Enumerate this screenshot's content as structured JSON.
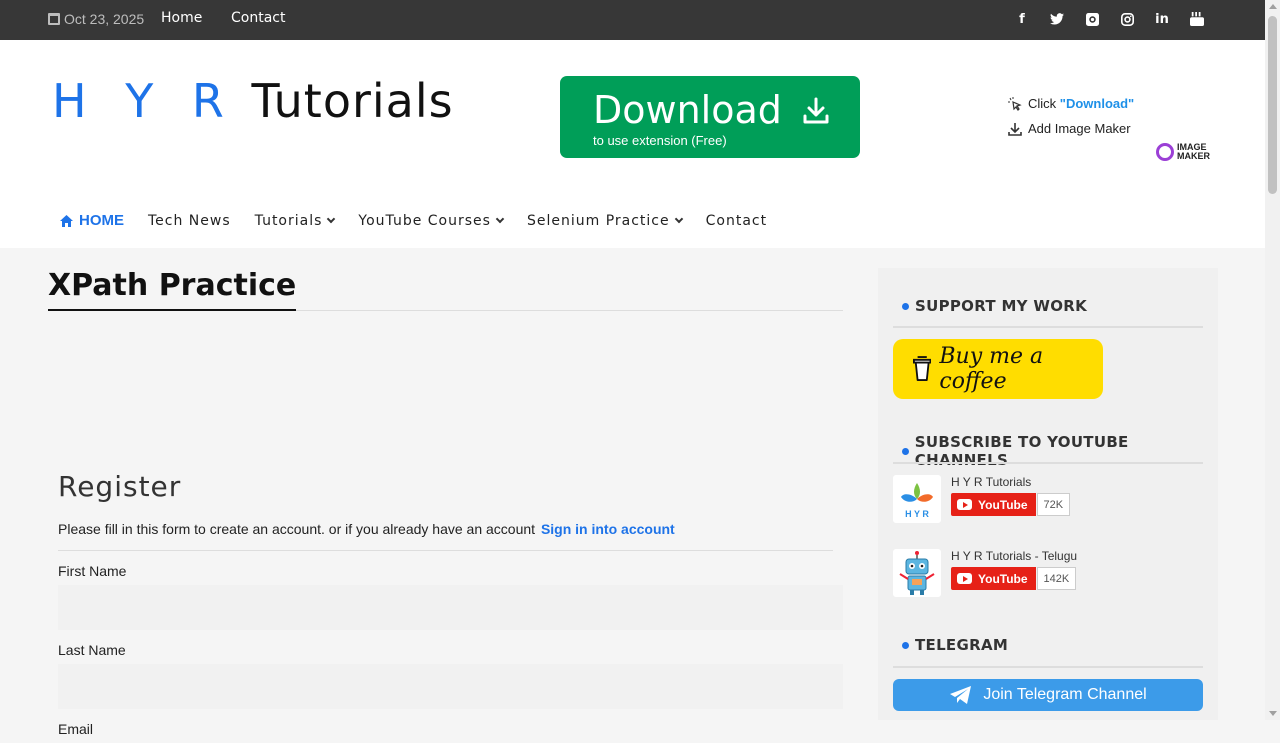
{
  "topbar": {
    "date": "Oct 23, 2025",
    "links": [
      "Home",
      "Contact"
    ],
    "social_icons": [
      "facebook-icon",
      "twitter-icon",
      "github-icon",
      "instagram-icon",
      "linkedin-icon",
      "youtube-icon"
    ]
  },
  "header": {
    "logo_hyr": "H Y R",
    "logo_tutorials": "Tutorials",
    "ad": {
      "title": "Download",
      "subtitle": "to use extension (Free)",
      "click_prefix": "Click ",
      "click_highlight": "\"Download\"",
      "add_text": "Add Image Maker",
      "brand_line1": "IMAGE",
      "brand_line2": "MAKER"
    }
  },
  "nav": {
    "home": "HOME",
    "tech_news": "Tech News",
    "tutorials": "Tutorials",
    "youtube_courses": "YouTube Courses",
    "selenium_practice": "Selenium Practice",
    "contact": "Contact"
  },
  "main": {
    "title": "XPath Practice",
    "register": {
      "heading": "Register",
      "intro": "Please fill in this form to create an account. or if you already have an account",
      "signin_link": "Sign in into account",
      "first_name_label": "First Name",
      "last_name_label": "Last Name",
      "email_label": "Email"
    }
  },
  "sidebar": {
    "support_title": "SUPPORT MY WORK",
    "coffee_label": "Buy me a coffee",
    "subscribe_title": "SUBSCRIBE TO YOUTUBE CHANNELS",
    "channels": [
      {
        "name": "H Y R Tutorials",
        "button": "YouTube",
        "count": "72K",
        "thumb_text": "H Y R"
      },
      {
        "name": "H Y R Tutorials - Telugu",
        "button": "YouTube",
        "count": "142K"
      }
    ],
    "telegram_title": "TELEGRAM",
    "telegram_button": "Join Telegram Channel"
  },
  "colors": {
    "accent": "#1e73e8",
    "download_green": "#009e58",
    "coffee_yellow": "#ffdd00",
    "youtube_red": "#e62117",
    "telegram_blue": "#3c9be9",
    "topbar": "#373737"
  }
}
